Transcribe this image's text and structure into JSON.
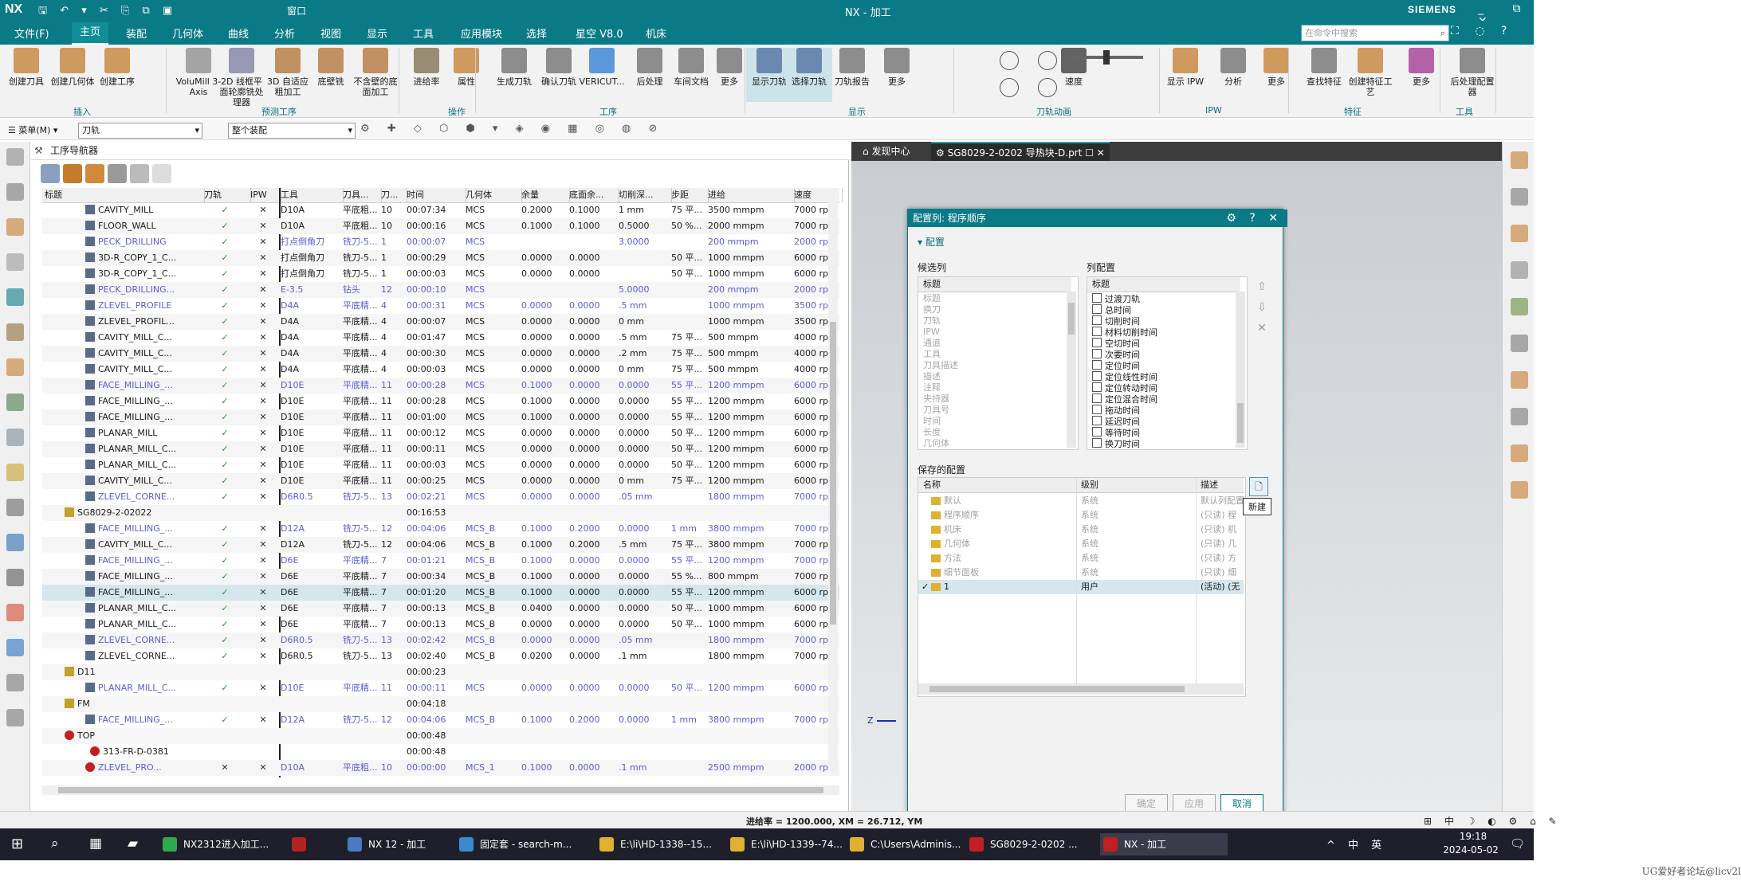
{
  "titlebar": {
    "logo": "NX",
    "title": "NX - 加工",
    "brand": "SIEMENS",
    "window_menu": "窗口",
    "controls": "_ ⧉ ✕"
  },
  "menu": {
    "items": [
      "文件(F)",
      "主页",
      "装配",
      "几何体",
      "曲线",
      "分析",
      "视图",
      "显示",
      "工具",
      "应用模块",
      "选择",
      "星空 V8.0",
      "机床"
    ],
    "active": "主页",
    "search_placeholder": "在命令中搜索"
  },
  "ribbon": {
    "buttons": [
      {
        "label": "创建刀具",
        "icon": "create-tool-icon",
        "color": "#c47c2c"
      },
      {
        "label": "创建几何体",
        "icon": "create-geometry-icon",
        "color": "#c47c2c"
      },
      {
        "label": "创建工序",
        "icon": "create-operation-icon",
        "color": "#c47c2c"
      },
      {
        "label": "VoluMill 3-Axis",
        "icon": "volumill-icon",
        "color": "#8a8a8a"
      },
      {
        "label": "2D 线框平面轮廓铣处理器",
        "icon": "wireframe-icon",
        "color": "#7a7aa0"
      },
      {
        "label": "3D 自适应粗加工",
        "icon": "adaptive-roughing-icon",
        "color": "#b07030"
      },
      {
        "label": "底壁铣",
        "icon": "floor-wall-icon",
        "color": "#b07030"
      },
      {
        "label": "不含壁的底面加工",
        "icon": "floor-no-wall-icon",
        "color": "#b07030"
      },
      {
        "label": "进给率",
        "icon": "feedrate-icon",
        "color": "#7a6a4a"
      },
      {
        "label": "属性",
        "icon": "properties-icon",
        "color": "#c47c2c"
      },
      {
        "label": "生成刀轨",
        "icon": "generate-path-icon",
        "color": "#6a6a6a"
      },
      {
        "label": "确认刀轨",
        "icon": "verify-path-icon",
        "color": "#6a6a6a"
      },
      {
        "label": "VERICUT...",
        "icon": "vericut-icon",
        "color": "#2a7ad0"
      },
      {
        "label": "后处理",
        "icon": "postprocess-icon",
        "color": "#6a6a6a"
      },
      {
        "label": "车间文档",
        "icon": "shop-doc-icon",
        "color": "#6a6a6a"
      },
      {
        "label": "更多",
        "icon": "more-icon",
        "color": "#6a6a6a"
      },
      {
        "label": "显示刀轨",
        "icon": "display-path-icon",
        "color": "#4a6a9a",
        "selected": true
      },
      {
        "label": "选择刀轨",
        "icon": "select-path-icon",
        "color": "#4a6a9a",
        "selected": true
      },
      {
        "label": "刀轨报告",
        "icon": "path-report-icon",
        "color": "#6a6a6a"
      },
      {
        "label": "更多",
        "icon": "more-icon",
        "color": "#6a6a6a"
      },
      {
        "label": "速度",
        "icon": "speed-slider-icon",
        "color": "#333333"
      },
      {
        "label": "显示 IPW",
        "icon": "display-ipw-icon",
        "color": "#c47c2c"
      },
      {
        "label": "分析",
        "icon": "analysis-icon",
        "color": "#6a6a6a"
      },
      {
        "label": "更多",
        "icon": "more-icon",
        "color": "#c47c2c"
      },
      {
        "label": "查找特征",
        "icon": "find-feature-icon",
        "color": "#6a6a6a"
      },
      {
        "label": "创建特征工艺",
        "icon": "feature-process-icon",
        "color": "#c47c2c"
      },
      {
        "label": "更多",
        "icon": "more-icon",
        "color": "#a03090"
      },
      {
        "label": "后处理配置器",
        "icon": "post-config-icon",
        "color": "#6a6a6a"
      }
    ],
    "groups": [
      "插入",
      "预测工序",
      "操作",
      "工序",
      "显示",
      "刀轨动画",
      "IPW",
      "特征",
      "工具"
    ]
  },
  "selection_bar": {
    "menu_label": "菜单(M)",
    "filter_value": "刀轨",
    "scope_value": "整个装配"
  },
  "navigator": {
    "title": "工序导航器",
    "columns": [
      "标题",
      "刀轨",
      "IPW",
      "工具",
      "刀具...",
      "刀...",
      "时间",
      "几何体",
      "余量",
      "底面余...",
      "切削深...",
      "步距",
      "进给",
      "速度"
    ],
    "rows": [
      {
        "name": "CAVITY_MILL",
        "path": "✓",
        "ipw": "✕",
        "tool": "D10A",
        "tooldesc": "平底粗...",
        "toolno": "10",
        "time": "00:07:34",
        "geom": "MCS",
        "stock": "0.2000",
        "floor": "0.1000",
        "depth": "1 mm",
        "step": "75 平...",
        "feed": "3500 mmpm",
        "speed": "7000 rpm",
        "blue": false
      },
      {
        "name": "FLOOR_WALL",
        "path": "✓",
        "ipw": "✕",
        "tool": "D10A",
        "tooldesc": "平底粗...",
        "toolno": "10",
        "time": "00:00:16",
        "geom": "MCS",
        "stock": "0.1000",
        "floor": "0.1000",
        "depth": "0.5000",
        "step": "50 %...",
        "feed": "2000 mmpm",
        "speed": "7000 rpm",
        "blue": false
      },
      {
        "name": "PECK_DRILLING",
        "path": "✓",
        "ipw": "✕",
        "tool": "打点倒角刀",
        "tooldesc": "铣刀-5...",
        "toolno": "1",
        "time": "00:00:07",
        "geom": "MCS",
        "stock": "",
        "floor": "",
        "depth": "3.0000",
        "step": "",
        "feed": "200 mmpm",
        "speed": "2000 rpm",
        "blue": true
      },
      {
        "name": "3D-R_COPY_1_C...",
        "path": "✓",
        "ipw": "✕",
        "tool": "打点倒角刀",
        "tooldesc": "铣刀-5...",
        "toolno": "1",
        "time": "00:00:29",
        "geom": "MCS",
        "stock": "0.0000",
        "floor": "0.0000",
        "depth": "",
        "step": "50 平...",
        "feed": "1000 mmpm",
        "speed": "6000 rpm",
        "blue": false
      },
      {
        "name": "3D-R_COPY_1_C...",
        "path": "✓",
        "ipw": "✕",
        "tool": "打点倒角刀",
        "tooldesc": "铣刀-5...",
        "toolno": "1",
        "time": "00:00:03",
        "geom": "MCS",
        "stock": "0.0000",
        "floor": "0.0000",
        "depth": "",
        "step": "50 平...",
        "feed": "1000 mmpm",
        "speed": "6000 rpm",
        "blue": false
      },
      {
        "name": "PECK_DRILLING...",
        "path": "✓",
        "ipw": "✕",
        "tool": "E-3.5",
        "tooldesc": "钻头",
        "toolno": "12",
        "time": "00:00:10",
        "geom": "MCS",
        "stock": "",
        "floor": "",
        "depth": "5.0000",
        "step": "",
        "feed": "200 mmpm",
        "speed": "2000 rpm",
        "blue": true
      },
      {
        "name": "ZLEVEL_PROFILE",
        "path": "✓",
        "ipw": "✕",
        "tool": "D4A",
        "tooldesc": "平底精...",
        "toolno": "4",
        "time": "00:00:31",
        "geom": "MCS",
        "stock": "0.0000",
        "floor": "0.0000",
        "depth": ".5 mm",
        "step": "",
        "feed": "1000 mmpm",
        "speed": "3500 rpm",
        "blue": true
      },
      {
        "name": "ZLEVEL_PROFIL...",
        "path": "✓",
        "ipw": "✕",
        "tool": "D4A",
        "tooldesc": "平底精...",
        "toolno": "4",
        "time": "00:00:07",
        "geom": "MCS",
        "stock": "0.0000",
        "floor": "0.0000",
        "depth": "0 mm",
        "step": "",
        "feed": "1000 mmpm",
        "speed": "3500 rpm",
        "blue": false
      },
      {
        "name": "CAVITY_MILL_C...",
        "path": "✓",
        "ipw": "✕",
        "tool": "D4A",
        "tooldesc": "平底精...",
        "toolno": "4",
        "time": "00:01:47",
        "geom": "MCS",
        "stock": "0.0000",
        "floor": "0.0000",
        "depth": ".5 mm",
        "step": "75 平...",
        "feed": "500 mmpm",
        "speed": "4000 rpm",
        "blue": false
      },
      {
        "name": "CAVITY_MILL_C...",
        "path": "✓",
        "ipw": "✕",
        "tool": "D4A",
        "tooldesc": "平底精...",
        "toolno": "4",
        "time": "00:00:30",
        "geom": "MCS",
        "stock": "0.0000",
        "floor": "0.0000",
        "depth": ".2 mm",
        "step": "75 平...",
        "feed": "500 mmpm",
        "speed": "4000 rpm",
        "blue": false
      },
      {
        "name": "CAVITY_MILL_C...",
        "path": "✓",
        "ipw": "✕",
        "tool": "D4A",
        "tooldesc": "平底精...",
        "toolno": "4",
        "time": "00:00:03",
        "geom": "MCS",
        "stock": "0.0000",
        "floor": "0.0000",
        "depth": "0 mm",
        "step": "75 平...",
        "feed": "500 mmpm",
        "speed": "4000 rpm",
        "blue": false
      },
      {
        "name": "FACE_MILLING_...",
        "path": "✓",
        "ipw": "✕",
        "tool": "D10E",
        "tooldesc": "平底精...",
        "toolno": "11",
        "time": "00:00:28",
        "geom": "MCS",
        "stock": "0.1000",
        "floor": "0.0000",
        "depth": "0.0000",
        "step": "55 平...",
        "feed": "1200 mmpm",
        "speed": "6000 rpm",
        "blue": true
      },
      {
        "name": "FACE_MILLING_...",
        "path": "✓",
        "ipw": "✕",
        "tool": "D10E",
        "tooldesc": "平底精...",
        "toolno": "11",
        "time": "00:00:28",
        "geom": "MCS",
        "stock": "0.1000",
        "floor": "0.0000",
        "depth": "0.0000",
        "step": "55 平...",
        "feed": "1200 mmpm",
        "speed": "6000 rpm",
        "blue": false
      },
      {
        "name": "FACE_MILLING_...",
        "path": "✓",
        "ipw": "✕",
        "tool": "D10E",
        "tooldesc": "平底精...",
        "toolno": "11",
        "time": "00:01:00",
        "geom": "MCS",
        "stock": "0.1000",
        "floor": "0.0000",
        "depth": "0.0000",
        "step": "55 平...",
        "feed": "1200 mmpm",
        "speed": "6000 rpm",
        "blue": false
      },
      {
        "name": "PLANAR_MILL",
        "path": "✓",
        "ipw": "✕",
        "tool": "D10E",
        "tooldesc": "平底精...",
        "toolno": "11",
        "time": "00:00:12",
        "geom": "MCS",
        "stock": "0.0000",
        "floor": "0.0000",
        "depth": "0.0000",
        "step": "50 平...",
        "feed": "1200 mmpm",
        "speed": "6000 rpm",
        "blue": false
      },
      {
        "name": "PLANAR_MILL_C...",
        "path": "✓",
        "ipw": "✕",
        "tool": "D10E",
        "tooldesc": "平底精...",
        "toolno": "11",
        "time": "00:00:11",
        "geom": "MCS",
        "stock": "0.0000",
        "floor": "0.0000",
        "depth": "0.0000",
        "step": "50 平...",
        "feed": "1200 mmpm",
        "speed": "6000 rpm",
        "blue": false
      },
      {
        "name": "PLANAR_MILL_C...",
        "path": "✓",
        "ipw": "✕",
        "tool": "D10E",
        "tooldesc": "平底精...",
        "toolno": "11",
        "time": "00:00:03",
        "geom": "MCS",
        "stock": "0.0000",
        "floor": "0.0000",
        "depth": "0.0000",
        "step": "50 平...",
        "feed": "1200 mmpm",
        "speed": "6000 rpm",
        "blue": false
      },
      {
        "name": "CAVITY_MILL_C...",
        "path": "✓",
        "ipw": "✕",
        "tool": "D10E",
        "tooldesc": "平底精...",
        "toolno": "11",
        "time": "00:00:25",
        "geom": "MCS",
        "stock": "0.0000",
        "floor": "0.0000",
        "depth": "0 mm",
        "step": "75 平...",
        "feed": "1200 mmpm",
        "speed": "6000 rpm",
        "blue": false
      },
      {
        "name": "ZLEVEL_CORNE...",
        "path": "✓",
        "ipw": "✕",
        "tool": "D6R0.5",
        "tooldesc": "铣刀-5...",
        "toolno": "13",
        "time": "00:02:21",
        "geom": "MCS",
        "stock": "0.0000",
        "floor": "0.0000",
        "depth": ".05 mm",
        "step": "",
        "feed": "1800 mmpm",
        "speed": "7000 rpm",
        "blue": true
      },
      {
        "name": "SG8029-2-02022",
        "group": true,
        "time": "00:16:53"
      },
      {
        "name": "FACE_MILLING_...",
        "path": "✓",
        "ipw": "✕",
        "tool": "D12A",
        "tooldesc": "铣刀-5...",
        "toolno": "12",
        "time": "00:04:06",
        "geom": "MCS_B",
        "stock": "0.1000",
        "floor": "0.2000",
        "depth": "0.0000",
        "step": "1 mm",
        "feed": "3800 mmpm",
        "speed": "7000 rpm",
        "blue": true
      },
      {
        "name": "CAVITY_MILL_C...",
        "path": "✓",
        "ipw": "✕",
        "tool": "D12A",
        "tooldesc": "铣刀-5...",
        "toolno": "12",
        "time": "00:04:06",
        "geom": "MCS_B",
        "stock": "0.1000",
        "floor": "0.2000",
        "depth": ".5 mm",
        "step": "75 平...",
        "feed": "3800 mmpm",
        "speed": "7000 rpm",
        "blue": false
      },
      {
        "name": "FACE_MILLING_...",
        "path": "✓",
        "ipw": "✕",
        "tool": "D6E",
        "tooldesc": "平底精...",
        "toolno": "7",
        "time": "00:01:21",
        "geom": "MCS_B",
        "stock": "0.1000",
        "floor": "0.0000",
        "depth": "0.0000",
        "step": "55 平...",
        "feed": "1200 mmpm",
        "speed": "7000 rpm",
        "blue": true
      },
      {
        "name": "FACE_MILLING_...",
        "path": "✓",
        "ipw": "✕",
        "tool": "D6E",
        "tooldesc": "平底精...",
        "toolno": "7",
        "time": "00:00:34",
        "geom": "MCS_B",
        "stock": "0.1000",
        "floor": "0.0000",
        "depth": "0.0000",
        "step": "55 %...",
        "feed": "800 mmpm",
        "speed": "7000 rpm",
        "blue": false
      },
      {
        "name": "FACE_MILLING_...",
        "path": "✓",
        "ipw": "✕",
        "tool": "D6E",
        "tooldesc": "平底精...",
        "toolno": "7",
        "time": "00:01:20",
        "geom": "MCS_B",
        "stock": "0.1000",
        "floor": "0.0000",
        "depth": "0.0000",
        "step": "55 平...",
        "feed": "1200 mmpm",
        "speed": "6000 rpm",
        "blue": false,
        "highlight": true
      },
      {
        "name": "PLANAR_MILL_C...",
        "path": "✓",
        "ipw": "✕",
        "tool": "D6E",
        "tooldesc": "平底精...",
        "toolno": "7",
        "time": "00:00:13",
        "geom": "MCS_B",
        "stock": "0.0400",
        "floor": "0.0000",
        "depth": "0.0000",
        "step": "50 平...",
        "feed": "1000 mmpm",
        "speed": "6000 rpm",
        "blue": false
      },
      {
        "name": "PLANAR_MILL_C...",
        "path": "✓",
        "ipw": "✕",
        "tool": "D6E",
        "tooldesc": "平底精...",
        "toolno": "7",
        "time": "00:00:13",
        "geom": "MCS_B",
        "stock": "0.0000",
        "floor": "0.0000",
        "depth": "0.0000",
        "step": "50 平...",
        "feed": "1000 mmpm",
        "speed": "6000 rpm",
        "blue": false
      },
      {
        "name": "ZLEVEL_CORNE...",
        "path": "✓",
        "ipw": "✕",
        "tool": "D6R0.5",
        "tooldesc": "铣刀-5...",
        "toolno": "13",
        "time": "00:02:42",
        "geom": "MCS_B",
        "stock": "0.0000",
        "floor": "0.0000",
        "depth": ".05 mm",
        "step": "",
        "feed": "1800 mmpm",
        "speed": "7000 rpm",
        "blue": true
      },
      {
        "name": "ZLEVEL_CORNE...",
        "path": "✓",
        "ipw": "✕",
        "tool": "D6R0.5",
        "tooldesc": "铣刀-5...",
        "toolno": "13",
        "time": "00:02:40",
        "geom": "MCS_B",
        "stock": "0.0200",
        "floor": "0.0000",
        "depth": ".1 mm",
        "step": "",
        "feed": "1800 mmpm",
        "speed": "7000 rpm",
        "blue": false
      },
      {
        "name": "D11",
        "group": true,
        "time": "00:00:23"
      },
      {
        "name": "PLANAR_MILL_C...",
        "path": "✓",
        "ipw": "✕",
        "tool": "D10E",
        "tooldesc": "平底精...",
        "toolno": "11",
        "time": "00:00:11",
        "geom": "MCS",
        "stock": "0.0000",
        "floor": "0.0000",
        "depth": "0.0000",
        "step": "50 平...",
        "feed": "1200 mmpm",
        "speed": "6000 rpm",
        "blue": true
      },
      {
        "name": "FM",
        "group": true,
        "time": "00:04:18"
      },
      {
        "name": "FACE_MILLING_...",
        "path": "✓",
        "ipw": "✕",
        "tool": "D12A",
        "tooldesc": "铣刀-5...",
        "toolno": "12",
        "time": "00:04:06",
        "geom": "MCS_B",
        "stock": "0.1000",
        "floor": "0.2000",
        "depth": "0.0000",
        "step": "1 mm",
        "feed": "3800 mmpm",
        "speed": "7000 rpm",
        "blue": true
      },
      {
        "name": "TOP",
        "group": true,
        "time": "00:00:48",
        "error": true
      },
      {
        "name": "313-FR-D-0381",
        "group": true,
        "time": "00:00:48",
        "error": true
      },
      {
        "name": "ZLEVEL_PRO...",
        "path": "✕",
        "ipw": "✕",
        "tool": "D10A",
        "tooldesc": "平底粗...",
        "toolno": "10",
        "time": "00:00:00",
        "geom": "MCS_1",
        "stock": "0.1000",
        "floor": "0.0000",
        "depth": ".1 mm",
        "step": "",
        "feed": "2500 mmpm",
        "speed": "2000 rpm",
        "blue": true,
        "error": true
      }
    ]
  },
  "doc_tabs": [
    {
      "label": "发现中心"
    },
    {
      "label": "SG8029-2-0202 导热块-D.prt"
    }
  ],
  "graphics": {
    "axis_label": "Z"
  },
  "dialog": {
    "title": "配置列: 程序顺序",
    "section": "配置",
    "candidate_label": "候选列",
    "candidate_header": "标题",
    "candidates": [
      "标题",
      "换刀",
      "刀轨",
      "IPW",
      "通道",
      "工具",
      "刀具描述",
      "描述",
      "注释",
      "夹持器",
      "刀具号",
      "时间",
      "长度",
      "几何体"
    ],
    "column_config_label": "列配置",
    "column_config_header": "标题",
    "column_config": [
      "过渡刀轨",
      "总时间",
      "切削时间",
      "材料切削时间",
      "空切时间",
      "次要时间",
      "定位时间",
      "定位线性时间",
      "定位转动时间",
      "定位混合时间",
      "拖动时间",
      "延迟时间",
      "等待时间",
      "换刀时间"
    ],
    "saved_label": "保存的配置",
    "saved_headers": [
      "名称",
      "级别",
      "描述"
    ],
    "saved": [
      {
        "name": "默认",
        "level": "系统",
        "desc": "默认列配置",
        "dim": true
      },
      {
        "name": "程序顺序",
        "level": "系统",
        "desc": "(只读) 程",
        "dim": true
      },
      {
        "name": "机床",
        "level": "系统",
        "desc": "(只读) 机",
        "dim": true
      },
      {
        "name": "几何体",
        "level": "系统",
        "desc": "(只读) 几",
        "dim": true
      },
      {
        "name": "方法",
        "level": "系统",
        "desc": "(只读) 方",
        "dim": true
      },
      {
        "name": "细节面板",
        "level": "系统",
        "desc": "(只读) 细",
        "dim": true
      },
      {
        "name": "1",
        "level": "用户",
        "desc": "(活动) (无",
        "dim": false,
        "active": true
      }
    ],
    "tooltip": "新建",
    "buttons": {
      "ok": "确定",
      "apply": "应用",
      "cancel": "取消"
    }
  },
  "status": {
    "text": "进给率 = 1200.000, XM = 26.712, YM"
  },
  "taskbar": {
    "items": [
      {
        "label": "NX2312进入加工...",
        "color": "#2fa84f"
      },
      {
        "label": "",
        "color": "#b22222"
      },
      {
        "label": "NX 12 - 加工",
        "color": "#4a7ac0"
      },
      {
        "label": "固定套 - search-m...",
        "color": "#3a8ad0"
      },
      {
        "label": "E:\\li\\HD-1338--15...",
        "color": "#e0b030"
      },
      {
        "label": "E:\\li\\HD-1339--74...",
        "color": "#e0b030"
      },
      {
        "label": "C:\\Users\\Adminis...",
        "color": "#e0b030"
      },
      {
        "label": "SG8029-2-0202 ...",
        "color": "#c02020"
      },
      {
        "label": "NX - 加工",
        "color": "#c02020",
        "active": true
      }
    ],
    "clock_time": "19:18",
    "clock_date": "2024-05-02",
    "tray": "^ 中 英"
  },
  "watermark": "UG爱好者论坛@licv2l"
}
